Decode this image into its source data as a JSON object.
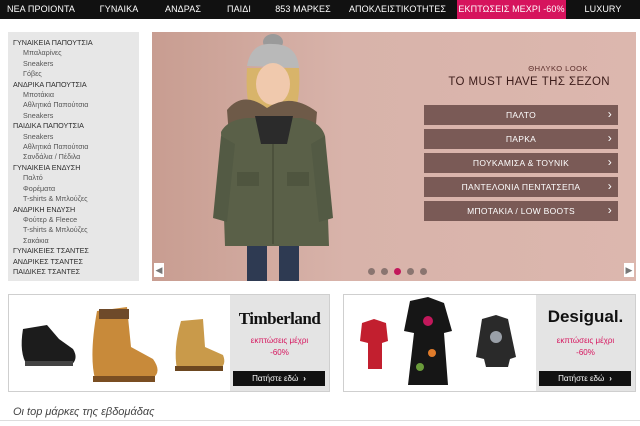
{
  "nav": {
    "items": [
      "ΝΕΑ ΠΡΟΙΟΝΤΑ",
      "ΓΥΝΑΙΚΑ",
      "ΑΝΔΡΑΣ",
      "ΠΑΙΔΙ",
      "853 ΜΑΡΚΕΣ",
      "ΑΠΟΚΛΕΙΣΤΙΚΟΤΗΤΕΣ",
      "ΕΚΠΤΩΣΕΙΣ ΜΕΧΡΙ -60%",
      "LUXURY"
    ],
    "sale_color": "#d6145d"
  },
  "sidebar": {
    "items": [
      "ΓΥΝΑΙΚΕΙΑ ΠΑΠΟΥΤΣΙΑ",
      "Μπαλαρίνες",
      "Sneakers",
      "Γόβες",
      "ΑΝΔΡΙΚΑ ΠΑΠΟΥΤΣΙΑ",
      "Μποτάκια",
      "Αθλητικά Παπούτσια",
      "Sneakers",
      "ΠΑΙΔΙΚΑ ΠΑΠΟΥΤΣΙΑ",
      "Sneakers",
      "Αθλητικά Παπούτσια",
      "Σανδάλια / Πέδιλα",
      "ΓΥΝΑΙΚΕΙΑ ΕΝΔΥΣΗ",
      "Παλτό",
      "Φορέματα",
      "T-shirts & Μπλούζες",
      "ΑΝΔΡΙΚΗ ΕΝΔΥΣΗ",
      "Φούτερ & Fleece",
      "T-shirts & Μπλούζες",
      "Σακάκια",
      "ΓΥΝΑΙΚΕΙΕΣ ΤΣΑΝΤΕΣ",
      "ΑΝΔΡΙΚΕΣ ΤΣΑΝΤΕΣ",
      "ΠΑΙΔΙΚΕΣ ΤΣΑΝΤΕΣ"
    ]
  },
  "hero": {
    "tag": "ΘΗΛΥΚΟ LOOK",
    "title": "TO MUST HAVE ΤΗΣ ΣΕΖΟΝ",
    "buttons": [
      "ΠΑΛΤΟ",
      "ΠΑΡΚΑ",
      "ΠΟΥΚΑΜΙΣΑ & ΤΟΥΝΙΚ",
      "ΠΑΝΤΕΛΟΝΙΑ ΠΕΝΤΑΤΣΕΠΑ",
      "ΜΠΟΤΑΚΙΑ / LOW BOOTS"
    ],
    "chevron": "›",
    "prev_arrow": "◀",
    "next_arrow": "▶",
    "slide_count": 5,
    "active_slide": 3
  },
  "promos": [
    {
      "brand": "Timberland",
      "line1": "εκπτώσεις μέχρι",
      "line2": "-60%",
      "cta": "Πατήστε εδώ",
      "chevron": "›"
    },
    {
      "brand": "Desigual.",
      "line1": "εκπτώσεις μέχρι",
      "line2": "-60%",
      "cta": "Πατήστε εδώ",
      "chevron": "›"
    }
  ],
  "weekly_title": "Οι top μάρκες της εβδομάδας"
}
